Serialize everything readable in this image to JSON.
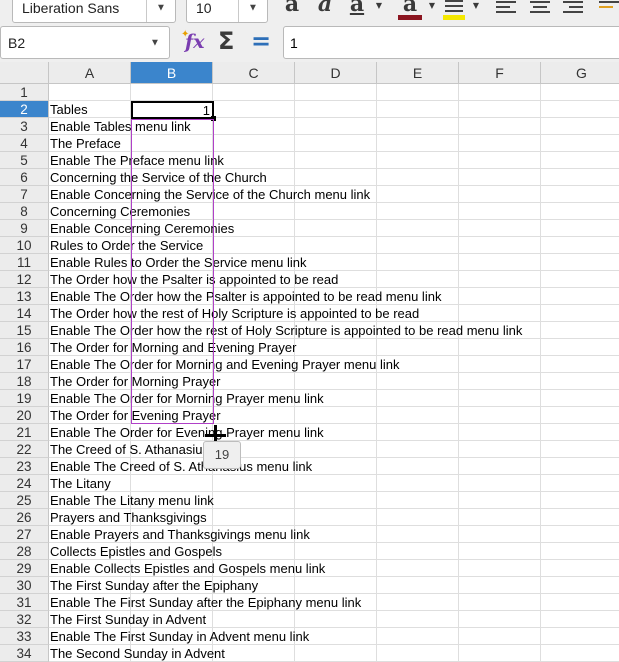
{
  "toolbar": {
    "font_name": "Liberation Sans",
    "font_size": "10",
    "dropdown_arrow": "▼",
    "bold_label": "a",
    "italic_label": "a",
    "underline_label": "a",
    "font_color_label": "a",
    "font_color": "#8b1520",
    "highlight_color": "#f5e800"
  },
  "formula_bar": {
    "name_box": "B2",
    "fx_symbol": "fx",
    "sum_symbol": "Σ",
    "equals_symbol": "=",
    "content": "1"
  },
  "sheet": {
    "columns": [
      "A",
      "B",
      "C",
      "D",
      "E",
      "F",
      "G"
    ],
    "selected_column": "B",
    "selected_row": 2,
    "active_cell": {
      "ref": "B2",
      "value": "1"
    },
    "fill_tooltip": "19",
    "rows": [
      {
        "num": "1",
        "a": ""
      },
      {
        "num": "2",
        "a": "Tables"
      },
      {
        "num": "3",
        "a": "Enable Tables menu link"
      },
      {
        "num": "4",
        "a": "The Preface"
      },
      {
        "num": "5",
        "a": "Enable The Preface menu link"
      },
      {
        "num": "6",
        "a": "Concerning the Service of the Church"
      },
      {
        "num": "7",
        "a": "Enable Concerning the Service of the Church menu link"
      },
      {
        "num": "8",
        "a": "Concerning Ceremonies"
      },
      {
        "num": "9",
        "a": "Enable Concerning Ceremonies"
      },
      {
        "num": "10",
        "a": "Rules to Order the Service"
      },
      {
        "num": "11",
        "a": "Enable Rules to Order the Service menu link"
      },
      {
        "num": "12",
        "a": "The Order how the Psalter is appointed to be read"
      },
      {
        "num": "13",
        "a": "Enable The Order how the Psalter is appointed to be read menu link"
      },
      {
        "num": "14",
        "a": "The Order how the rest of Holy Scripture is appointed to be read"
      },
      {
        "num": "15",
        "a": "Enable The Order how the rest of Holy Scripture is appointed to be read menu link"
      },
      {
        "num": "16",
        "a": "The Order for Morning and Evening Prayer"
      },
      {
        "num": "17",
        "a": "Enable The Order for Morning and Evening Prayer menu link"
      },
      {
        "num": "18",
        "a": "The Order for Morning Prayer"
      },
      {
        "num": "19",
        "a": "Enable The Order for Morning Prayer menu link"
      },
      {
        "num": "20",
        "a": "The Order for Evening Prayer"
      },
      {
        "num": "21",
        "a": "Enable The Order for Evening Prayer menu link"
      },
      {
        "num": "22",
        "a": "The Creed of S. Athanasius"
      },
      {
        "num": "23",
        "a": "Enable The Creed of S. Athanasius menu link"
      },
      {
        "num": "24",
        "a": "The Litany"
      },
      {
        "num": "25",
        "a": "Enable The Litany menu link"
      },
      {
        "num": "26",
        "a": "Prayers and Thanksgivings"
      },
      {
        "num": "27",
        "a": "Enable Prayers and Thanksgivings menu link"
      },
      {
        "num": "28",
        "a": "Collects Epistles and Gospels"
      },
      {
        "num": "29",
        "a": "Enable Collects Epistles and Gospels menu link"
      },
      {
        "num": "30",
        "a": "The First Sunday after the Epiphany"
      },
      {
        "num": "31",
        "a": "Enable The First Sunday after the Epiphany menu link"
      },
      {
        "num": "32",
        "a": "The First Sunday in Advent"
      },
      {
        "num": "33",
        "a": "Enable The First Sunday in Advent menu link"
      },
      {
        "num": "34",
        "a": "The Second Sunday in Advent"
      }
    ]
  }
}
